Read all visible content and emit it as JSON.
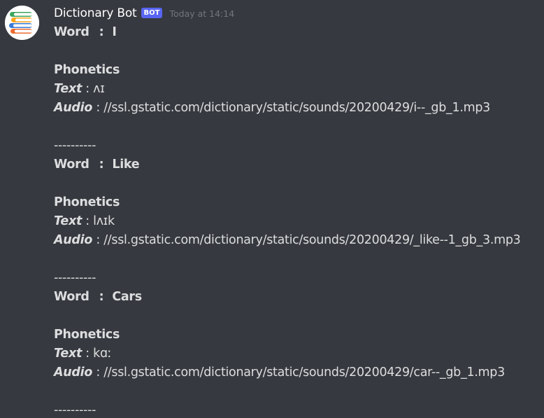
{
  "message": {
    "author": "Dictionary Bot",
    "bot_tag": "BOT",
    "timestamp": "Today at 14:14",
    "avatar_icon": "stacked-books-icon"
  },
  "labels": {
    "word": "Word",
    "colon": ":",
    "phonetics": "Phonetics",
    "text": "Text",
    "audio": "Audio",
    "inline_colon": ":",
    "separator": "----------"
  },
  "entries": [
    {
      "word": "I",
      "phonetic_text": "ʌɪ",
      "audio": "//ssl.gstatic.com/dictionary/static/sounds/20200429/i--_gb_1.mp3"
    },
    {
      "word": "Like",
      "phonetic_text": "lʌɪk",
      "audio": "//ssl.gstatic.com/dictionary/static/sounds/20200429/_like--1_gb_3.mp3"
    },
    {
      "word": "Cars",
      "phonetic_text": "kɑː",
      "audio": "//ssl.gstatic.com/dictionary/static/sounds/20200429/car--_gb_1.mp3"
    }
  ],
  "colors": {
    "background": "#36393f",
    "text": "#dcddde",
    "author": "#ffffff",
    "bot_tag": "#5865f2",
    "timestamp": "#72767d"
  }
}
